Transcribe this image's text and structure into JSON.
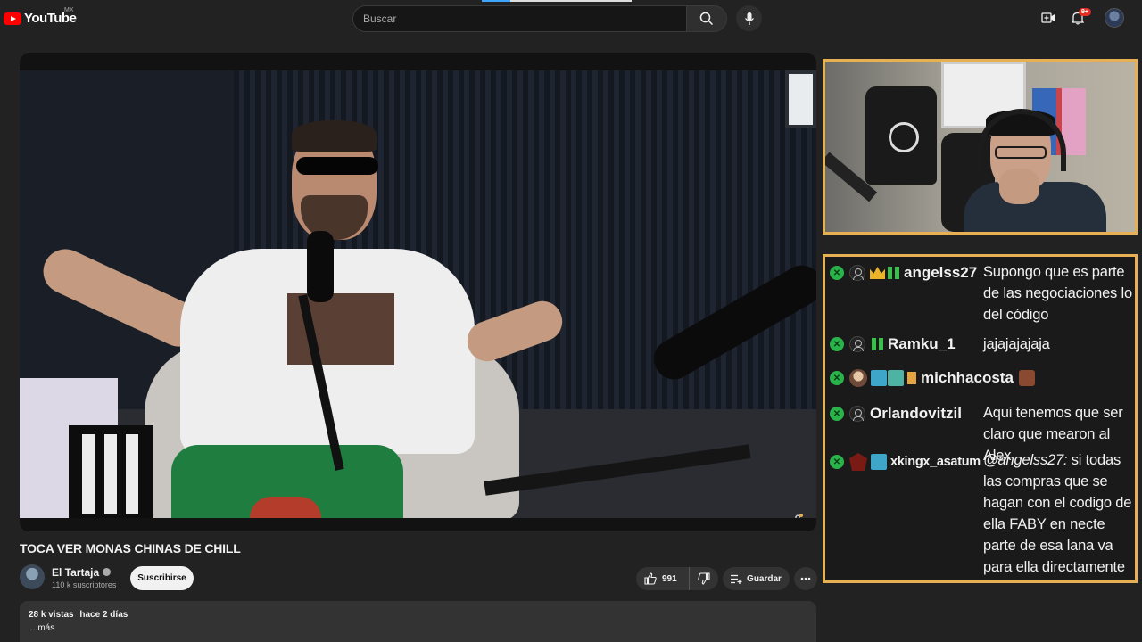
{
  "header": {
    "logo_text": "YouTube",
    "country_code": "MX",
    "search_placeholder": "Buscar",
    "notification_count": "9+"
  },
  "icons": {
    "search": "search-icon",
    "mic": "microphone-icon",
    "create": "create-video-icon",
    "notifications": "bell-icon",
    "like": "thumbs-up-icon",
    "dislike": "thumbs-down-icon",
    "save": "playlist-add-icon",
    "more": "more-horizontal-icon"
  },
  "video": {
    "title": "TOCA VER MONAS CHINAS DE CHILL",
    "channel_name": "El Tartaja",
    "subscribers": "110 k suscriptores",
    "subscribe_label": "Suscribirse",
    "like_count": "991",
    "save_label": "Guardar"
  },
  "description": {
    "views": "28 k vistas",
    "date": "hace 2 días",
    "more_label": "...más"
  },
  "chat": {
    "messages": [
      {
        "user": "angelss27",
        "text": "Supongo que es parte de las negociaciones lo del código"
      },
      {
        "user": "Ramku_1",
        "text": "jajajajajaja"
      },
      {
        "user": "michhacosta",
        "text": ""
      },
      {
        "user": "Orlandovitzil",
        "text": "Aqui tenemos que ser claro que mearon al Alex"
      },
      {
        "user": "xkingx_asatum",
        "mention": "@angelss27:",
        "text": "si todas las compras que se hagan con el codigo de ella FABY en necte parte de esa lana va para ella directamente"
      }
    ]
  },
  "colors": {
    "overlay_border": "#e8b054",
    "brand_red": "#ff0000",
    "chat_badge_green": "#2ab34a"
  }
}
